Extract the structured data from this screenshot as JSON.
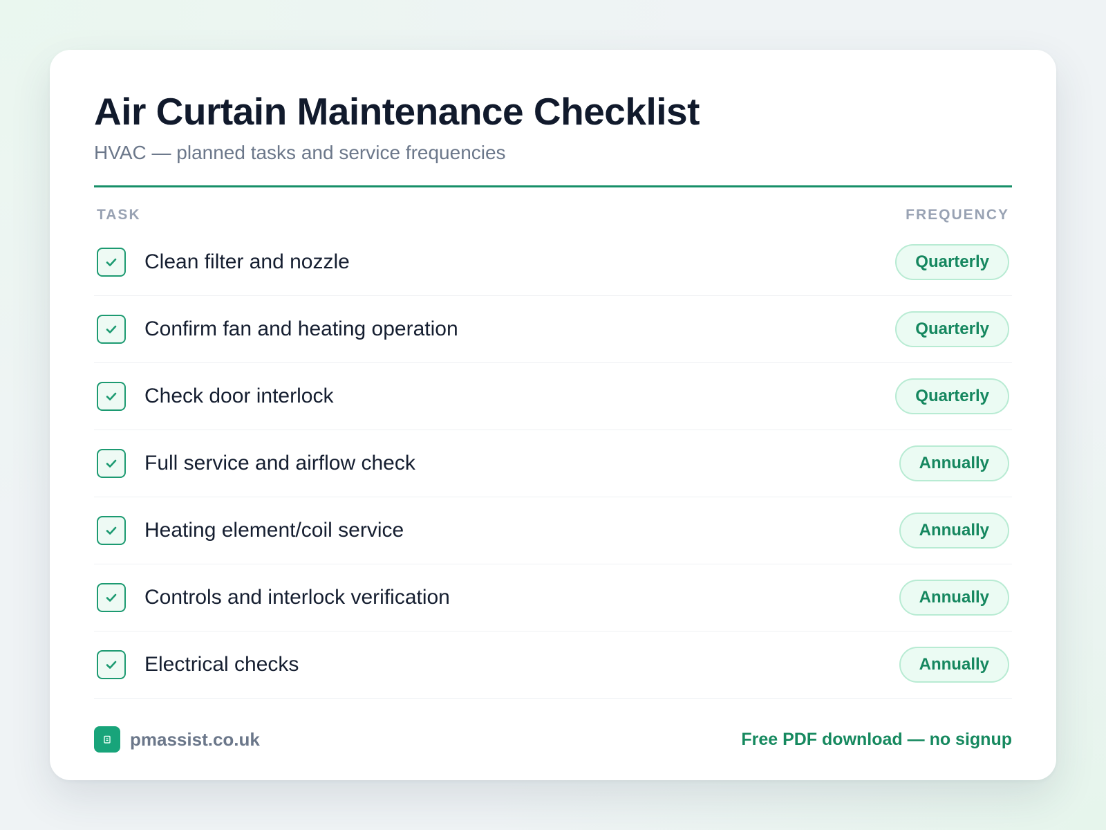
{
  "header": {
    "title": "Air Curtain Maintenance Checklist",
    "subtitle": "HVAC — planned tasks and service frequencies"
  },
  "columns": {
    "task": "TASK",
    "frequency": "FREQUENCY"
  },
  "tasks": [
    {
      "label": "Clean filter and nozzle",
      "frequency": "Quarterly",
      "checked": true
    },
    {
      "label": "Confirm fan and heating operation",
      "frequency": "Quarterly",
      "checked": true
    },
    {
      "label": "Check door interlock",
      "frequency": "Quarterly",
      "checked": true
    },
    {
      "label": "Full service and airflow check",
      "frequency": "Annually",
      "checked": true
    },
    {
      "label": "Heating element/coil service",
      "frequency": "Annually",
      "checked": true
    },
    {
      "label": "Controls and interlock verification",
      "frequency": "Annually",
      "checked": true
    },
    {
      "label": "Electrical checks",
      "frequency": "Annually",
      "checked": true
    }
  ],
  "footer": {
    "brand": "pmassist.co.uk",
    "cta": "Free PDF download — no signup"
  },
  "icons": {
    "checkbox": "check-icon",
    "logo": "building-icon"
  },
  "colors": {
    "accent": "#168f68",
    "badge_bg": "#ebfbf3",
    "badge_border": "#b8ebd3",
    "badge_text": "#15875f",
    "title": "#111a2c",
    "muted": "#6b778a"
  }
}
